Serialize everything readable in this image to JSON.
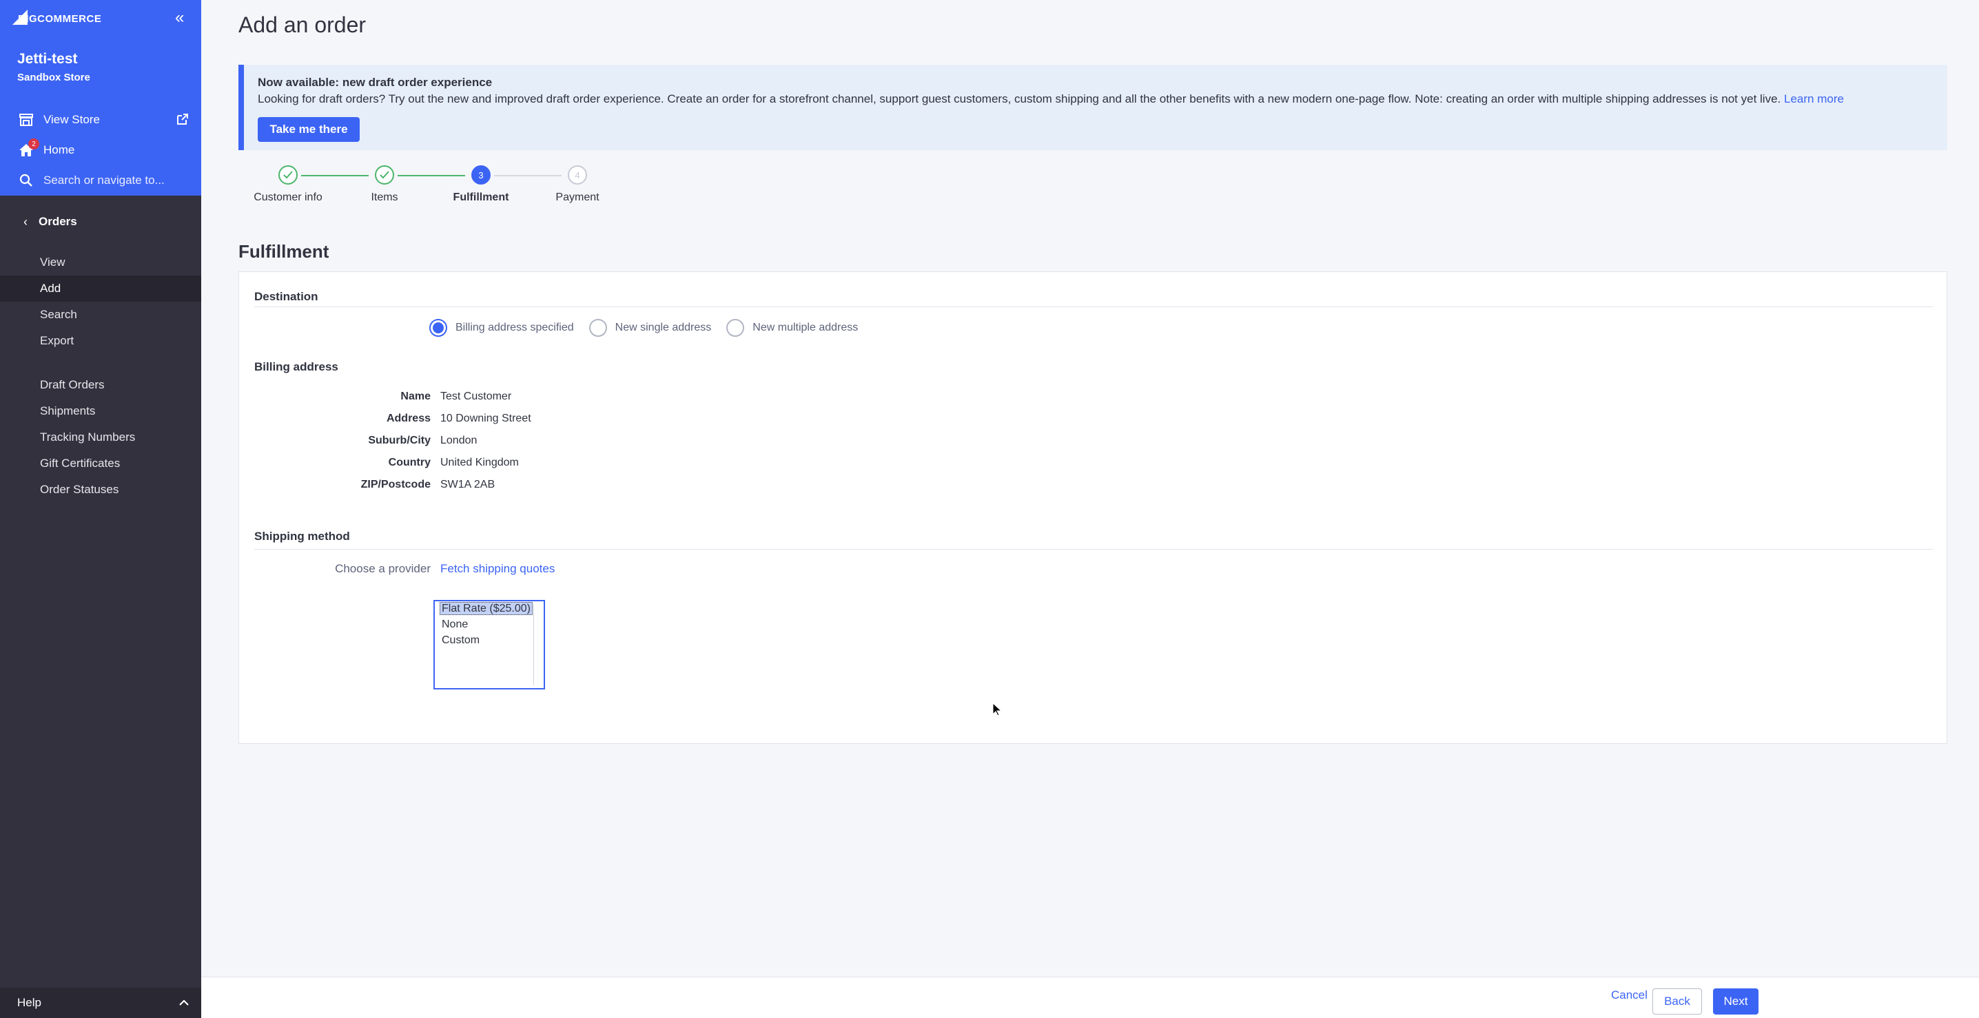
{
  "sidebar": {
    "logo_big": "BIG",
    "logo_rest": "COMMERCE",
    "store_name": "Jetti-test",
    "store_sub": "Sandbox Store",
    "view_store": "View Store",
    "home": "Home",
    "home_badge": "2",
    "search_placeholder": "Search or navigate to...",
    "section": "Orders",
    "nav": {
      "view": "View",
      "add": "Add",
      "search": "Search",
      "export": "Export",
      "draft_orders": "Draft Orders",
      "shipments": "Shipments",
      "tracking_numbers": "Tracking Numbers",
      "gift_certificates": "Gift Certificates",
      "order_statuses": "Order Statuses"
    },
    "help": "Help"
  },
  "page": {
    "title": "Add an order",
    "notice": {
      "title": "Now available: new draft order experience",
      "body": "Looking for draft orders? Try out the new and improved draft order experience. Create an order for a storefront channel, support guest customers, custom shipping and all the other benefits with a new modern one-page flow. Note: creating an order with multiple shipping addresses is not yet live.",
      "link": "Learn more",
      "button": "Take me there"
    },
    "steps": [
      {
        "label": "Customer info",
        "number": "1",
        "state": "done"
      },
      {
        "label": "Items",
        "number": "2",
        "state": "done"
      },
      {
        "label": "Fulfillment",
        "number": "3",
        "state": "current"
      },
      {
        "label": "Payment",
        "number": "4",
        "state": "todo"
      }
    ],
    "section_title": "Fulfillment",
    "destination": {
      "heading": "Destination",
      "options": [
        "Billing address specified",
        "New single address",
        "New multiple address"
      ],
      "selected": "Billing address specified"
    },
    "billing": {
      "heading": "Billing address",
      "rows": [
        {
          "key": "Name",
          "value": "Test Customer"
        },
        {
          "key": "Address",
          "value": "10 Downing Street"
        },
        {
          "key": "Suburb/City",
          "value": "London"
        },
        {
          "key": "Country",
          "value": "United Kingdom"
        },
        {
          "key": "ZIP/Postcode",
          "value": "SW1A 2AB"
        }
      ]
    },
    "shipping": {
      "heading": "Shipping method",
      "provider_label": "Choose a provider",
      "fetch_link": "Fetch shipping quotes",
      "options": [
        "Flat Rate ($25.00)",
        "None",
        "Custom"
      ],
      "selected": "Flat Rate ($25.00)"
    }
  },
  "footer": {
    "cancel": "Cancel",
    "back": "Back",
    "next": "Next"
  },
  "colors": {
    "brand": "#3c64f4",
    "sidebar": "#34313f",
    "success": "#4cb56c"
  }
}
